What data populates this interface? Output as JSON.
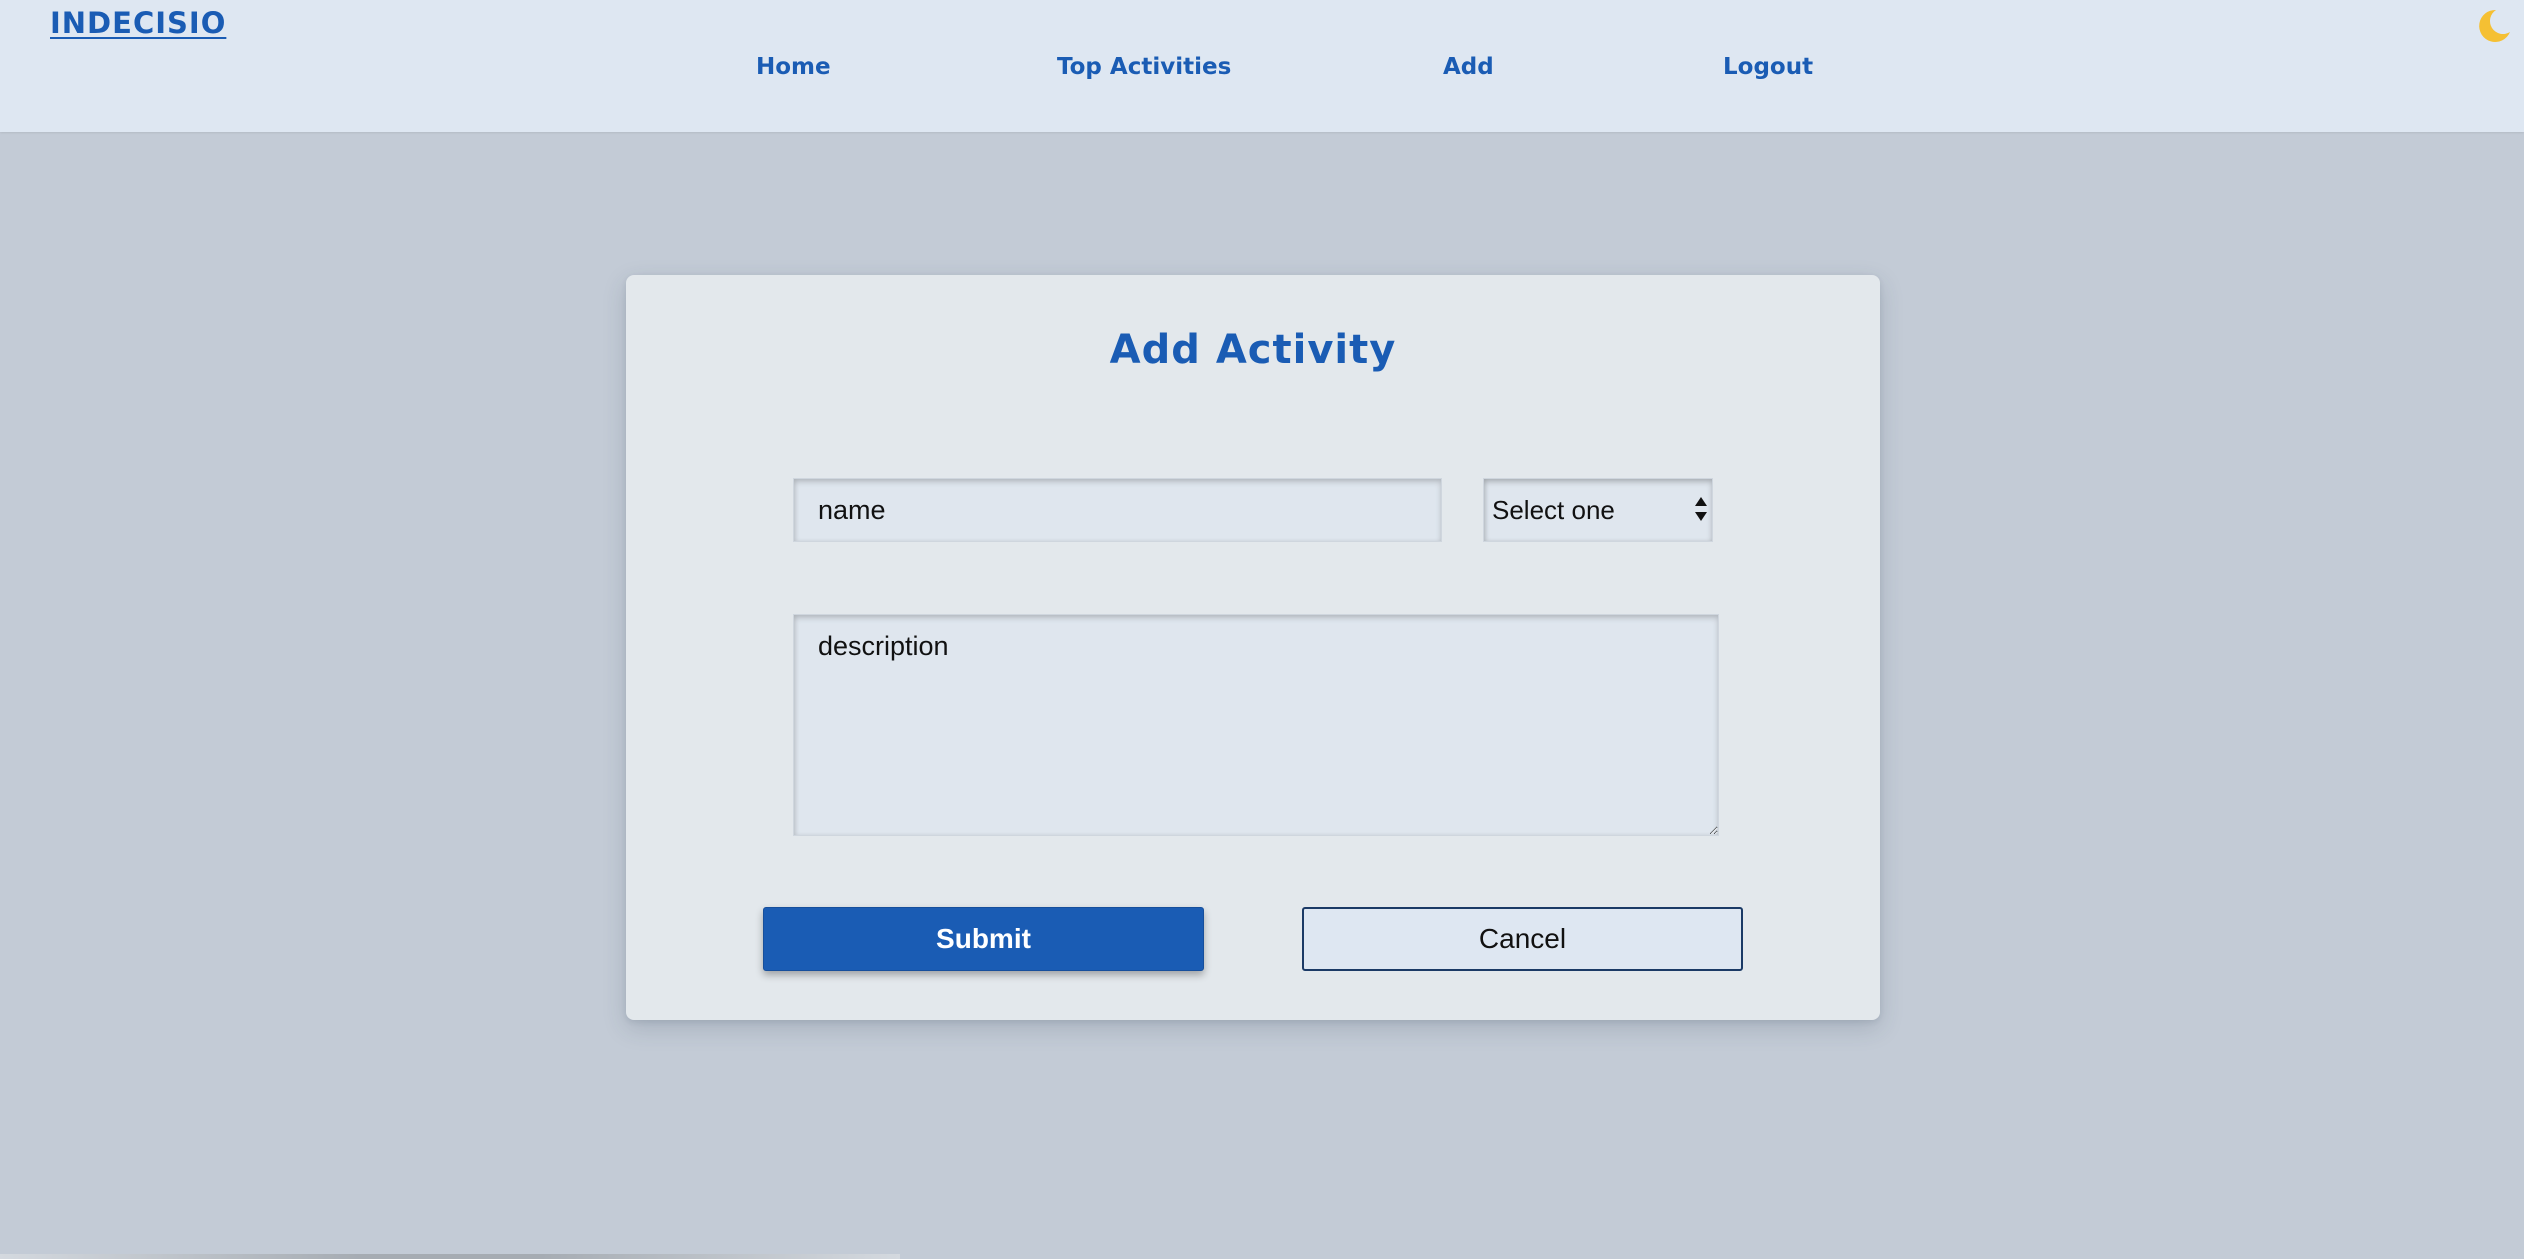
{
  "header": {
    "brand": "INDECISIO",
    "nav": {
      "home": "Home",
      "top_activities": "Top Activities",
      "add": "Add",
      "logout": "Logout"
    },
    "theme_toggle_icon": "moon-icon",
    "accent_color": "#1a5cb4",
    "moon_color": "#f5c033"
  },
  "form": {
    "title": "Add Activity",
    "name_placeholder": "name",
    "name_value": "",
    "select_value": "Select one",
    "description_placeholder": "description",
    "description_value": "",
    "submit_label": "Submit",
    "cancel_label": "Cancel"
  }
}
